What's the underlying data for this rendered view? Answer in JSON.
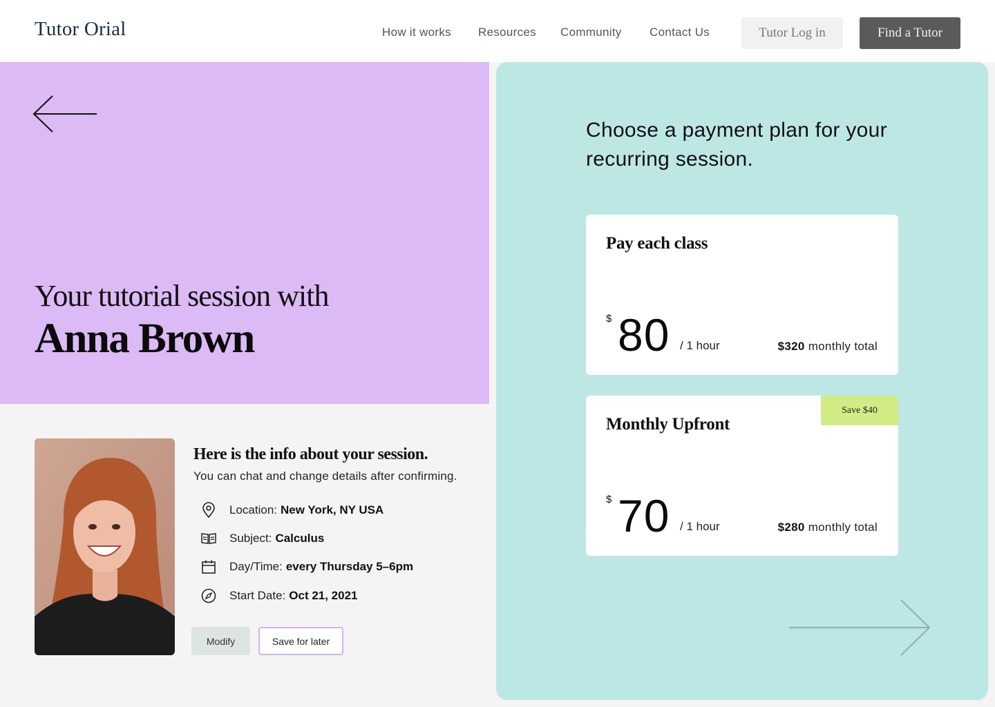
{
  "header": {
    "logo": "Tutor Orial",
    "nav": [
      "How it works",
      "Resources",
      "Community",
      "Contact Us"
    ],
    "login_label": "Tutor Log in",
    "find_label": "Find a Tutor"
  },
  "hero": {
    "subtitle": "Your tutorial session with",
    "tutor_name": "Anna Brown"
  },
  "session": {
    "title": "Here is the info about your session.",
    "subtitle": "You can chat and change details after confirming.",
    "details": [
      {
        "icon": "location-pin-icon",
        "label": "Location:",
        "value": "New York, NY USA"
      },
      {
        "icon": "open-book-icon",
        "label": "Subject:",
        "value": "Calculus"
      },
      {
        "icon": "calendar-icon",
        "label": "Day/Time:",
        "value": "every Thursday 5–6pm"
      },
      {
        "icon": "compass-icon",
        "label": "Start Date:",
        "value": "Oct 21, 2021"
      }
    ],
    "modify_label": "Modify",
    "save_label": "Save for later"
  },
  "payment": {
    "title": "Choose a payment plan for your recurring session.",
    "plans": [
      {
        "name": "Pay each class",
        "currency": "$",
        "amount": "80",
        "unit": "/ 1 hour",
        "total_amount": "$320",
        "total_label": "monthly total",
        "badge": ""
      },
      {
        "name": "Monthly Upfront",
        "currency": "$",
        "amount": "70",
        "unit": "/ 1 hour",
        "total_amount": "$280",
        "total_label": "monthly total",
        "badge": "Save $40"
      }
    ]
  },
  "colors": {
    "hero_bg": "#dcbaf5",
    "panel_bg": "#bde7e5",
    "badge_bg": "#d2ec85",
    "find_button_bg": "#5a5a5a"
  }
}
